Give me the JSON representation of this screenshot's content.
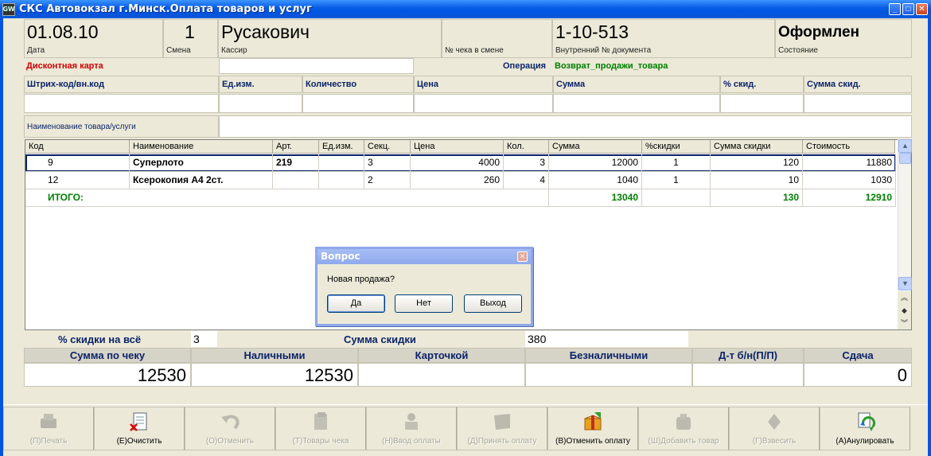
{
  "window": {
    "title": "СКС Автовокзал г.Минск.Оплата товаров и услуг",
    "icon_text": "GW"
  },
  "header": {
    "date": "01.08.10",
    "date_label": "Дата",
    "shift": "1",
    "shift_label": "Смена",
    "cashier": "Русакович",
    "cashier_label": "Кассир",
    "check_in_shift_label": "№ чека в смене",
    "doc_number": "1-10-513",
    "doc_number_label": "Внутренний № документа",
    "state": "Оформлен",
    "state_label": "Состояние"
  },
  "form": {
    "discount_card_label": "Дисконтная карта",
    "operation_label": "Операция",
    "operation_value": "Возврат_продажи_товара",
    "barcode_label": "Штрих-код/вн.код",
    "unit_label": "Ед.изм.",
    "qty_label": "Количество",
    "price_label": "Цена",
    "sum_label": "Сумма",
    "disc_pct_label": "% скид.",
    "disc_sum_label": "Сумма скид.",
    "name_label": "Наименование товара/услуги"
  },
  "table": {
    "columns": [
      "Код",
      "Наименование",
      "Арт.",
      "Ед.изм.",
      "Секц.",
      "Цена",
      "Кол.",
      "Сумма",
      "%скидки",
      "Сумма скидки",
      "Стоимость"
    ],
    "rows": [
      {
        "code": "9",
        "name": "Суперлото",
        "art": "219",
        "unit": "",
        "sect": "3",
        "price": "4000",
        "qty": "3",
        "sum": "12000",
        "disc_pct": "1",
        "disc_sum": "120",
        "cost": "11880"
      },
      {
        "code": "12",
        "name": "Ксерокопия А4 2ст.",
        "art": "",
        "unit": "",
        "sect": "2",
        "price": "260",
        "qty": "4",
        "sum": "1040",
        "disc_pct": "1",
        "disc_sum": "10",
        "cost": "1030"
      }
    ],
    "total": {
      "label": "ИТОГО:",
      "sum": "13040",
      "disc_sum": "130",
      "cost": "12910"
    }
  },
  "dialog": {
    "title": "Вопрос",
    "message": "Новая продажа?",
    "yes": "Да",
    "no": "Нет",
    "exit": "Выход"
  },
  "summary": {
    "disc_all_label": "% скидки на всё",
    "disc_all_value": "3",
    "disc_sum_label": "Сумма скидки",
    "disc_sum_value": "380",
    "check_sum_label": "Сумма по чеку",
    "check_sum_value": "12530",
    "cash_label": "Наличными",
    "cash_value": "12530",
    "card_label": "Карточкой",
    "card_value": "",
    "noncash_label": "Безналичными",
    "noncash_value": "",
    "dt_label": "Д-т б/н(П/П)",
    "dt_value": "",
    "change_label": "Сдача",
    "change_value": "0"
  },
  "toolbar": {
    "print": "(П)Печать",
    "clear": "(E)Очистить",
    "cancel": "(O)Отменить",
    "goods": "(T)Товары чека",
    "enter_pay": "(H)Ввод оплаты",
    "accept_pay": "(Д)Принять оплату",
    "cancel_pay": "(B)Отменить оплату",
    "add_goods": "(Ш)Добавить товар",
    "weigh": "(Г)Взвесить",
    "annul": "(A)Анулировать"
  },
  "colors": {
    "accent": "#0a246a",
    "total": "#008000",
    "discount_card": "#d00000",
    "title_bar": "#0054e3"
  }
}
